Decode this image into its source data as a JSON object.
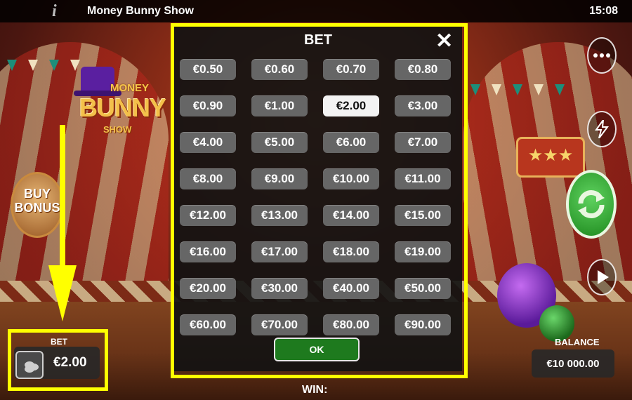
{
  "app": {
    "title": "Money Bunny Show",
    "clock": "15:08",
    "info_glyph": "i"
  },
  "logo": {
    "money": "MONEY",
    "bunny": "BUNNY",
    "show": "SHOW"
  },
  "buy_bonus": {
    "line1": "BUY",
    "line2": "BONUS"
  },
  "modal": {
    "title": "BET",
    "close_glyph": "✕",
    "selected": "€2.00",
    "options": [
      "€0.50",
      "€0.60",
      "€0.70",
      "€0.80",
      "€0.90",
      "€1.00",
      "€2.00",
      "€3.00",
      "€4.00",
      "€5.00",
      "€6.00",
      "€7.00",
      "€8.00",
      "€9.00",
      "€10.00",
      "€11.00",
      "€12.00",
      "€13.00",
      "€14.00",
      "€15.00",
      "€16.00",
      "€17.00",
      "€18.00",
      "€19.00",
      "€20.00",
      "€30.00",
      "€40.00",
      "€50.00",
      "€60.00",
      "€70.00",
      "€80.00",
      "€90.00"
    ],
    "ok_label": "OK"
  },
  "bet": {
    "label": "BET",
    "value": "€2.00"
  },
  "balance": {
    "label": "BALANCE",
    "value": "€10 000.00"
  },
  "win": {
    "label": "WIN:"
  },
  "icons": {
    "info": "info-icon",
    "menu": "more-dots-icon",
    "turbo": "lightning-icon",
    "spin": "spin-arrows-icon",
    "autoplay": "play-icon",
    "coins": "coins-icon",
    "close": "close-icon"
  },
  "annotation_color": "#ffff00"
}
